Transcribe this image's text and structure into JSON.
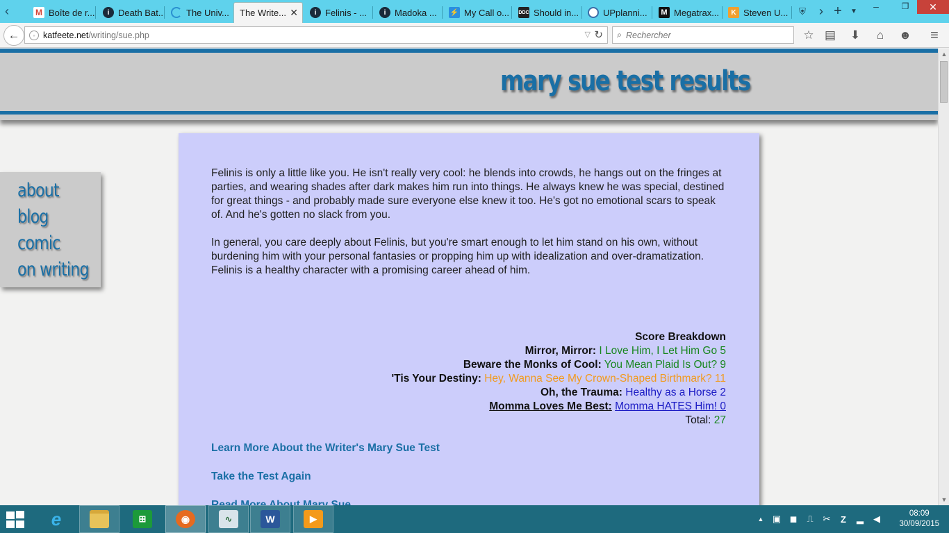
{
  "browser": {
    "tabs": [
      {
        "label": "Boîte de r...",
        "icon": "gmail-icon",
        "color": "#d44638",
        "active": false
      },
      {
        "label": "Death Bat...",
        "icon": "info-site-icon",
        "color": "#1a2a3a",
        "active": false
      },
      {
        "label": "The Univ...",
        "icon": "loading-icon",
        "color": "#2a90d0",
        "active": false
      },
      {
        "label": "The Write...",
        "icon": "none",
        "color": "",
        "active": true
      },
      {
        "label": "Felinis - ...",
        "icon": "info-site-icon",
        "color": "#1a2a3a",
        "active": false
      },
      {
        "label": "Madoka ...",
        "icon": "info-site-icon",
        "color": "#1a2a3a",
        "active": false
      },
      {
        "label": "My Call o...",
        "icon": "bolt-icon",
        "color": "#2a8fe0",
        "active": false
      },
      {
        "label": "Should in...",
        "icon": "ddc-icon",
        "color": "#222222",
        "active": false
      },
      {
        "label": "UPplanni...",
        "icon": "upplanning-icon",
        "color": "#3b6ea8",
        "active": false
      },
      {
        "label": "Megatrax...",
        "icon": "megatrax-icon",
        "color": "#111111",
        "active": false
      },
      {
        "label": "Steven U...",
        "icon": "k-icon",
        "color": "#f0a030",
        "active": false
      }
    ],
    "url_domain": "katfeete.net",
    "url_path": "/writing/sue.php",
    "search_placeholder": "Rechercher"
  },
  "site": {
    "title": "mary sue test results",
    "nav": [
      "about",
      "blog",
      "comic",
      "on writing"
    ]
  },
  "content": {
    "paragraph_1": "Felinis is only a little like you. He isn't really very cool: he blends into crowds, he hangs out on the fringes at parties, and wearing shades after dark makes him run into things. He always knew he was special, destined for great things - and probably made sure everyone else knew it too. He's got no emotional scars to speak of. And he's gotten no slack from you.",
    "paragraph_2": "In general, you care deeply about Felinis, but you're smart enough to let him stand on his own, without burdening him with your personal fantasies or propping him up with idealization and over-dramatization. Felinis is a healthy character with a promising career ahead of him.",
    "breakdown_heading": "Score Breakdown",
    "breakdown": [
      {
        "label": "Mirror, Mirror:",
        "result": "I Love Him, I Let Him Go 5",
        "color": "#17861d",
        "underline": false
      },
      {
        "label": "Beware the Monks of Cool:",
        "result": "You Mean Plaid Is Out? 9",
        "color": "#17861d",
        "underline": false
      },
      {
        "label": "'Tis Your Destiny:",
        "result": "Hey, Wanna See My Crown-Shaped Birthmark? 11",
        "color": "#f29a1e",
        "underline": false
      },
      {
        "label": "Oh, the Trauma:",
        "result": "Healthy as a Horse 2",
        "color": "#1b1bc4",
        "underline": false
      },
      {
        "label": "Momma Loves Me Best:",
        "result": "Momma HATES Him! 0",
        "color": "#1b1bc4",
        "underline": true
      }
    ],
    "total_label": "Total:",
    "total_value": "27",
    "total_color": "#17861d",
    "links": {
      "learn": "Learn More About the Writer's Mary Sue Test",
      "retake": "Take the Test Again",
      "readmore": "Read More About Mary Sue"
    }
  },
  "taskbar": {
    "time": "08:09",
    "date": "30/09/2015"
  },
  "colors": {
    "accent": "#1a6fa5",
    "card": "#cccdfb",
    "tabbar": "#5fd2ec",
    "taskbar": "#1e6a7e"
  }
}
